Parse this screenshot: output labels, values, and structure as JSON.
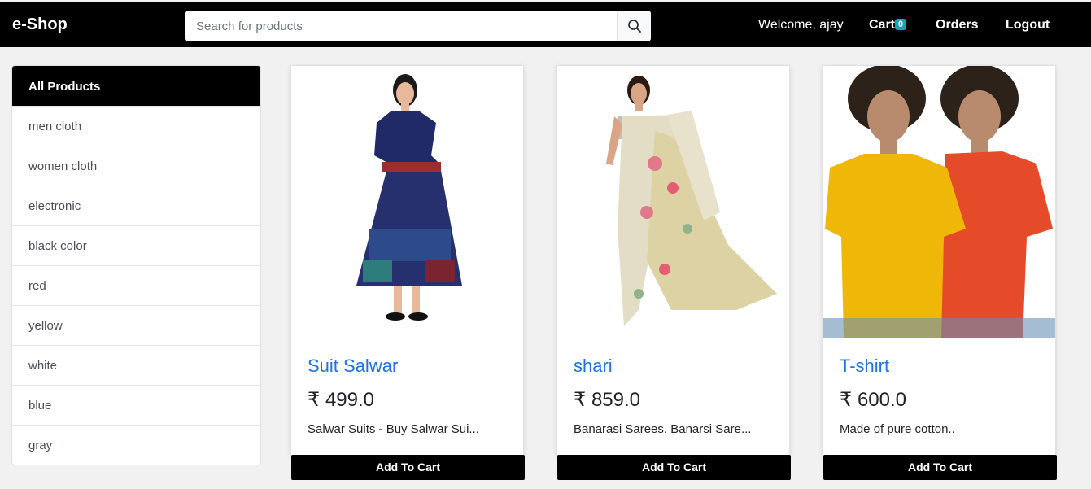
{
  "navbar": {
    "brand": "e-Shop",
    "search_placeholder": "Search for products",
    "welcome": "Welcome, ajay",
    "cart_label": "Cart",
    "cart_count": "0",
    "orders_label": "Orders",
    "logout_label": "Logout"
  },
  "sidebar": {
    "header": "All Products",
    "items": [
      {
        "label": "men cloth"
      },
      {
        "label": "women cloth"
      },
      {
        "label": "electronic"
      },
      {
        "label": "black color"
      },
      {
        "label": "red"
      },
      {
        "label": "yellow"
      },
      {
        "label": "white"
      },
      {
        "label": "blue"
      },
      {
        "label": "gray"
      }
    ]
  },
  "products": [
    {
      "title": "Suit Salwar",
      "price": "₹ 499.0",
      "desc": "Salwar Suits - Buy Salwar Sui...",
      "button": "Add To Cart"
    },
    {
      "title": "shari",
      "price": "₹ 859.0",
      "desc": "Banarasi Sarees. Banarsi Sare...",
      "button": "Add To Cart"
    },
    {
      "title": "T-shirt",
      "price": "₹ 600.0",
      "desc": "Made of pure cotton..",
      "button": "Add To Cart"
    }
  ],
  "colors": {
    "navbar_bg": "#000000",
    "link_blue": "#1a73e8",
    "badge": "#17a2b8",
    "page_bg": "#f1f1f1"
  }
}
